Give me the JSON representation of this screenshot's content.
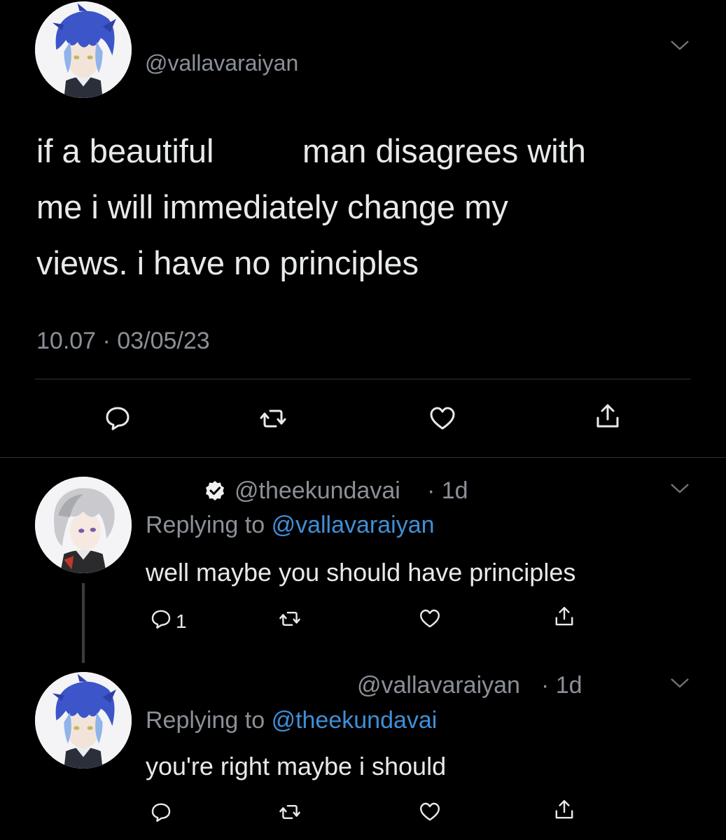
{
  "main_tweet": {
    "handle": "@vallavaraiyan",
    "text_line1_a": "if a beautiful",
    "text_line1_b": "man disagrees with",
    "text_line2": "me i will immediately change my",
    "text_line3": "views. i have no principles",
    "timestamp": "10.07 · 03/05/23",
    "avatar_icon": "blue-haired-anime-avatar-icon"
  },
  "reply1": {
    "handle": "@theekundavai",
    "age": "· 1d",
    "replying_prefix": "Replying to",
    "replying_to": "@vallavaraiyan",
    "text": "well maybe you should have principles",
    "reply_count": "1",
    "verified_icon": "verified-check-icon",
    "avatar_icon": "silver-haired-anime-avatar-icon"
  },
  "reply2": {
    "handle": "@vallavaraiyan",
    "age": "· 1d",
    "replying_prefix": "Replying to",
    "replying_to": "@theekundavai",
    "text": "you're right maybe i should",
    "avatar_icon": "blue-haired-anime-avatar-icon"
  },
  "colors": {
    "background": "#000000",
    "text": "#e7e9ea",
    "muted": "#8b9097",
    "link": "#3f8fd6"
  }
}
